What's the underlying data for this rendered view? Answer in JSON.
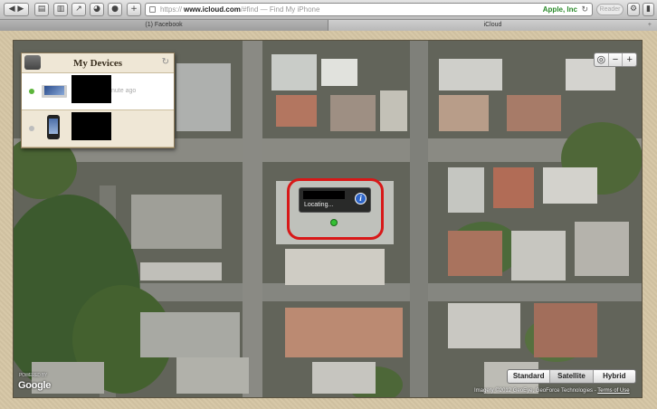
{
  "browser": {
    "url_scheme": "https://",
    "url_host": "www.icloud.com",
    "url_path": "/#find",
    "url_sep": " — ",
    "page_title": "Find My iPhone",
    "cert_owner": "Apple, Inc",
    "reader_label": "Reader",
    "tabs": [
      {
        "label": "(1) Facebook"
      },
      {
        "label": "iCloud"
      }
    ]
  },
  "panel": {
    "title": "My Devices",
    "devices": [
      {
        "status": "online",
        "meta": "nute ago",
        "icon": "macbook-icon"
      },
      {
        "status": "offline",
        "meta": "",
        "icon": "iphone-icon"
      }
    ]
  },
  "map": {
    "popup_status": "Locating...",
    "modes": [
      {
        "label": "Standard",
        "active": false
      },
      {
        "label": "Satellite",
        "active": true
      },
      {
        "label": "Hybrid",
        "active": false
      }
    ],
    "logo_text": "Google",
    "logo_sub": "POWERED BY",
    "attribution": "Imagery ©2012 GeoEye, GeoForce Technologies -",
    "terms": "Terms of Use"
  },
  "colors": {
    "highlight_ring": "#d81818",
    "online_dot": "#5cb53c",
    "frame": "#d6c6a5"
  }
}
